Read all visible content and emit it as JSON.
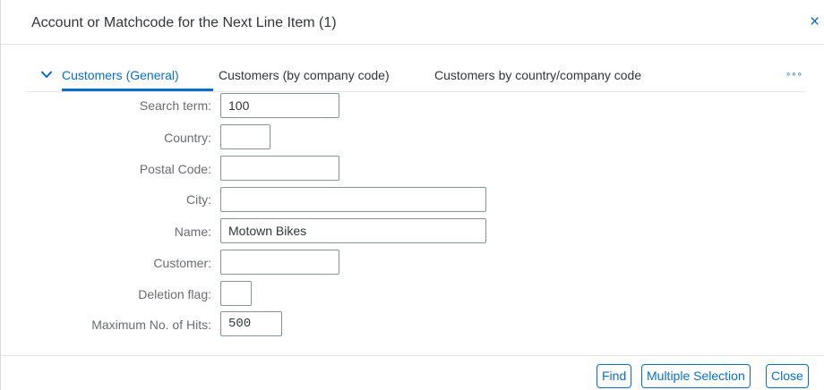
{
  "dialog": {
    "title": "Account or Matchcode for the Next Line Item (1)",
    "close_glyph": "×"
  },
  "tabs": [
    {
      "label": "Customers (General)",
      "active": true
    },
    {
      "label": "Customers (by company code)",
      "active": false
    },
    {
      "label": "Customers by country/company code",
      "active": false
    }
  ],
  "tab_icons": {
    "active_chevron": "chevron-down-icon",
    "overflow": "overflow-dots-icon",
    "overflow_glyph": "∘∘∘"
  },
  "form": {
    "search_term": {
      "label": "Search term:",
      "value": "100"
    },
    "country": {
      "label": "Country:",
      "value": ""
    },
    "postal_code": {
      "label": "Postal Code:",
      "value": ""
    },
    "city": {
      "label": "City:",
      "value": ""
    },
    "name": {
      "label": "Name:",
      "value": "Motown Bikes"
    },
    "customer": {
      "label": "Customer:",
      "value": ""
    },
    "deletion_flag": {
      "label": "Deletion flag:",
      "value": ""
    },
    "max_hits": {
      "label": "Maximum No. of Hits:",
      "value": "500"
    }
  },
  "footer": {
    "find_label": "Find",
    "multiple_selection_label": "Multiple Selection",
    "close_label": "Close"
  },
  "colors": {
    "accent": "#0a6ed1",
    "label_text": "#6a6d70",
    "field_border": "#89919a"
  }
}
